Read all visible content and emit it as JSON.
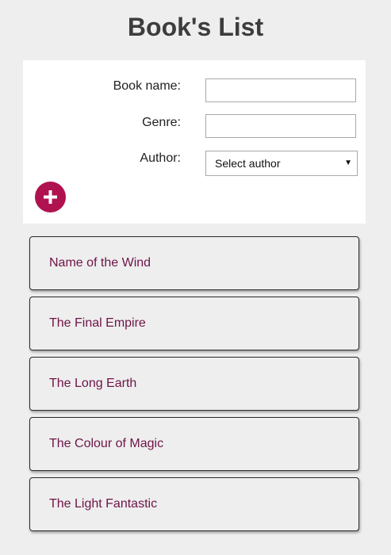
{
  "header": {
    "title": "Book's List"
  },
  "form": {
    "book_name_label": "Book name:",
    "book_name_value": "",
    "genre_label": "Genre:",
    "genre_value": "",
    "author_label": "Author:",
    "author_selected": "Select author",
    "add_icon": "plus-icon"
  },
  "books": [
    {
      "title": "Name of the Wind"
    },
    {
      "title": "The Final Empire"
    },
    {
      "title": "The Long Earth"
    },
    {
      "title": "The Colour of Magic"
    },
    {
      "title": "The Light Fantastic"
    }
  ],
  "colors": {
    "accent": "#b0124f",
    "book_title": "#6e1447",
    "background": "#eeeeee",
    "panel": "#ffffff"
  }
}
